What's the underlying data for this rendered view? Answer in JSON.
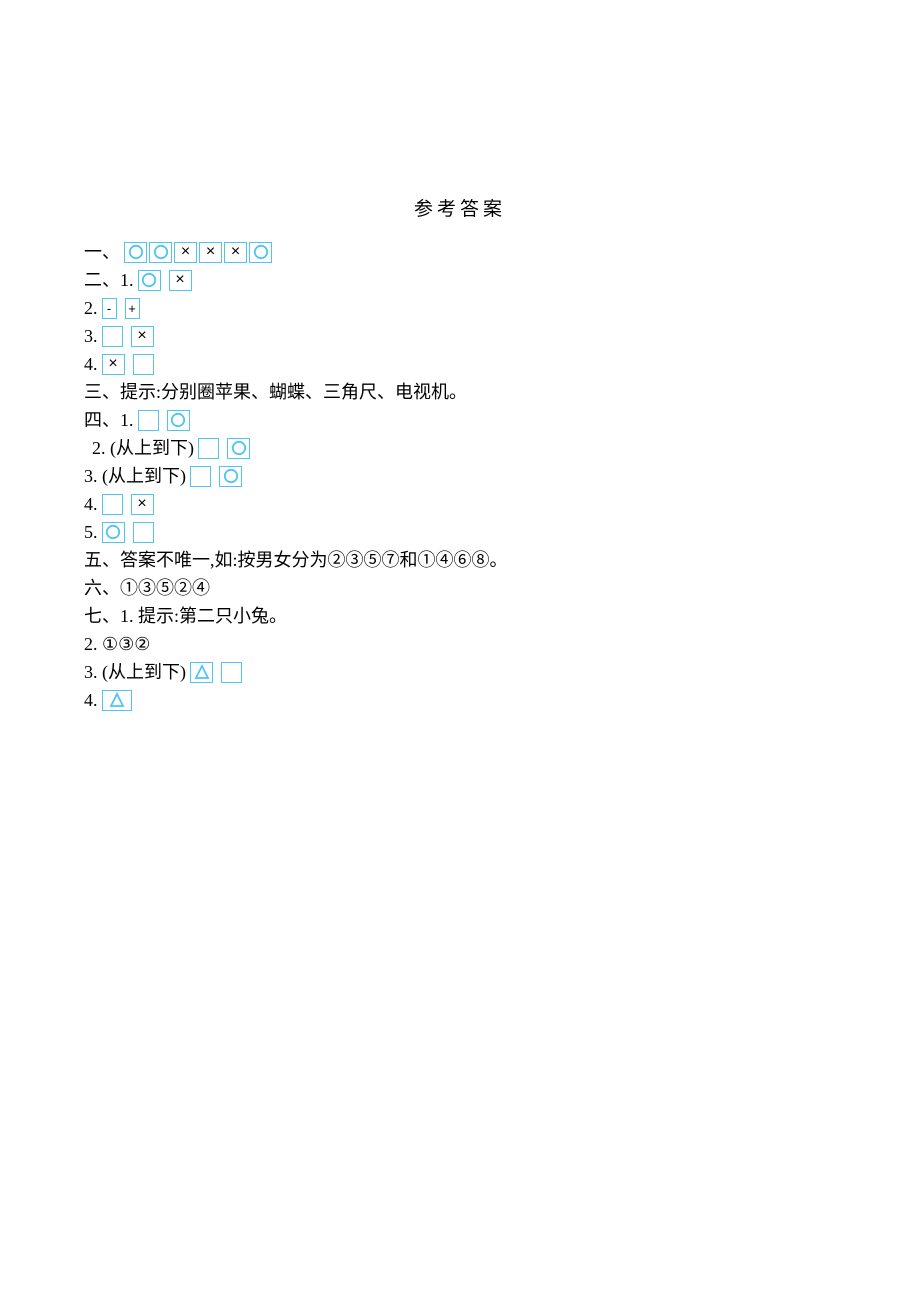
{
  "title": "参考答案",
  "labels": {
    "one": "一、",
    "two": "二、1.",
    "two_2": "2.",
    "two_3": "3.",
    "two_4": "4.",
    "three": "三、提示:分别圈苹果、蝴蝶、三角尺、电视机。",
    "four": "四、1.",
    "four_2": "2. (从上到下)",
    "four_3": "3. (从上到下)",
    "four_4": "4.",
    "four_5": "5.",
    "five": "五、答案不唯一,如:按男女分为②③⑤⑦和①④⑥⑧。",
    "six": "六、①③⑤②④",
    "seven": "七、1. 提示:第二只小兔。",
    "seven_2": "2. ①③②",
    "seven_3": "3. (从上到下)",
    "seven_4": "4."
  },
  "signs": {
    "minus": "-",
    "plus": "+",
    "x": "×"
  }
}
